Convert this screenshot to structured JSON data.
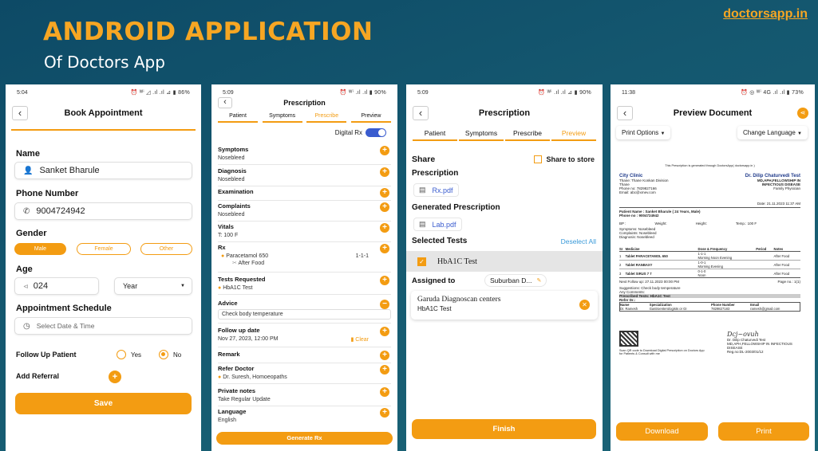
{
  "banner": {
    "title": "ANDROID APPLICATION",
    "subtitle": "Of Doctors App",
    "site": "doctorsapp.in"
  },
  "colors": {
    "accent": "#f39c12",
    "background": "#14576f",
    "title": "#f6a623"
  },
  "screen1": {
    "status_time": "5:04",
    "status_right": "⏰ ᵂⁱ ◿ .ıl .ıl ⊿ ▮ 86%",
    "header": "Book Appointment",
    "name_label": "Name",
    "name_value": "Sanket Bharule",
    "phone_label": "Phone Number",
    "phone_value": "9004724942",
    "gender_label": "Gender",
    "gender_options": [
      "Male",
      "Female",
      "Other"
    ],
    "age_label": "Age",
    "age_value": "024",
    "age_unit": "Year",
    "schedule_label": "Appointment Schedule",
    "schedule_placeholder": "Select Date & Time",
    "followup_label": "Follow Up Patient",
    "yes": "Yes",
    "no": "No",
    "referral_label": "Add Referral",
    "save": "Save"
  },
  "screen2": {
    "status_time": "5:09",
    "status_right": "⏰ ᵂⁱ .ıl .ıl ▮ 90%",
    "header": "Prescription",
    "tabs": [
      "Patient",
      "Symptoms",
      "Prescribe",
      "Preview"
    ],
    "digital_rx": "Digital Rx",
    "symptoms": "Symptoms",
    "symptoms_v": "Nosebleed",
    "diagnosis": "Diagnosis",
    "diagnosis_v": "Nosebleed",
    "examination": "Examination",
    "complaints": "Complaints",
    "complaints_v": "Nosebleed",
    "vitals": "Vitals",
    "vitals_v": "T: 100 F",
    "rx": "Rx",
    "rx_drug": "Paracetamol 650",
    "rx_dose": "1-1-1",
    "rx_food": "After Food",
    "tests": "Tests Requested",
    "tests_v": "HbA1C Test",
    "advice": "Advice",
    "advice_v": "Check body temperature",
    "followup": "Follow up date",
    "followup_v": "Nov 27, 2023, 12:00 PM",
    "clear": "Clear",
    "remark": "Remark",
    "refer": "Refer Doctor",
    "refer_v": "Dr. Suresh, Homoeopaths",
    "private": "Private notes",
    "private_v": "Take Regular Update",
    "language": "Language",
    "language_v": "English",
    "generate": "Generate Rx"
  },
  "screen3": {
    "status_time": "5:09",
    "status_right": "⏰ ᵂⁱ .ıl .ıl ⊿ ▮ 90%",
    "header": "Prescription",
    "tabs": [
      "Patient",
      "Symptoms",
      "Prescribe",
      "Preview"
    ],
    "share": "Share",
    "store": "Share to store",
    "prescription": "Prescription",
    "rx_file": "Rx.pdf",
    "generated": "Generated Prescription",
    "lab_file": "Lab.pdf",
    "selected_tests": "Selected Tests",
    "deselect": "Deselect All",
    "test": "HbA1C Test",
    "assigned": "Assigned to",
    "assigned_v": "Suburban D...",
    "center": "Garuda Diagnoscan centers",
    "center_test": "HbA1C Test",
    "finish": "Finish"
  },
  "screen4": {
    "status_time": "11:38",
    "status_right": "⏰ ◎ ᵂⁱ 4G .ıl .ıl ▮ 73%",
    "header": "Preview Document",
    "print_options": "Print Options",
    "change_language": "Change Language",
    "doc_top": "This Prescription is generated through DoctorsApp( doctorsapp.in )",
    "clinic": "City Clinic",
    "clinic_addr": "Thane: Thane Konkan Division",
    "clinic_city": "Thane",
    "clinic_phone": "Phone no: 7829827166",
    "clinic_email": "Email: abc@xmev.com",
    "doctor": "Dr. Dilip Chaturvedi Test",
    "doctor_deg": "MD,APH,FELLOWSHIP IN",
    "doctor_deg2": "INFECTIOUS DISEASE",
    "doctor_role": "Family Physician",
    "date": "Date: 21.11.2023 11:37 AM",
    "patient": "Patient Name : Sanket Bharule ( 24 Years, Male)",
    "patient_phone": "Phone no : 9004724942",
    "bp": "BP :",
    "weight": "Weight:",
    "height": "Height:",
    "temp": "Temp.: 100 F",
    "symptoms": "Symptoms: Nosebleed",
    "complaints": "Complaints: Nosebleed",
    "diagnosis": "Diagnosis: Nosebleed",
    "med_headers": [
      "Sr",
      "Medicine",
      "Dose & Frequency",
      "Period",
      "Notes"
    ],
    "meds": [
      {
        "sr": "1",
        "med": "Tablet PARACETAMOL 650",
        "dose": "1-1-1",
        "freq": "Morning Noon Evening",
        "notes": "After Food"
      },
      {
        "sr": "2",
        "med": "Tablet RANBAXY",
        "dose": "1-0-1",
        "freq": "Morning Evening",
        "notes": "After Food"
      },
      {
        "sr": "3",
        "med": "Tablet SIRUS 7 7",
        "dose": "0-1-0",
        "freq": "Noon",
        "notes": "After Food"
      }
    ],
    "next_followup": "Next Follow up: 27.11.2023 00:00 PM",
    "page_no": "Page no.: 1(1)",
    "suggestions": "Suggestions: Check body temperature",
    "comments": "Any Comments:",
    "prescribed_tests": "Prescribed Tests: HbA1C Test",
    "refer_dr": "Refer Dr.:",
    "ref_headers": [
      "Name",
      "Specialization",
      "Phone Number",
      "Email"
    ],
    "ref_row": [
      "Dr. Ramesh",
      "Gastroenterologists or GI",
      "7829827183",
      "ramesh@gmail.com"
    ],
    "qr_text": "Scan QR code to Download Digital Prescription on Doctors App for Patients & Consult with me",
    "sign_name": "Dr. Dilip Chaturvedi Test",
    "sign_deg": "MD,APH,FELLOWSHIP IN INFECTIOUS",
    "sign_deg2": "DISEASE",
    "sign_reg": "Reg.no:DL-2003/01/12",
    "download": "Download",
    "print": "Print"
  }
}
